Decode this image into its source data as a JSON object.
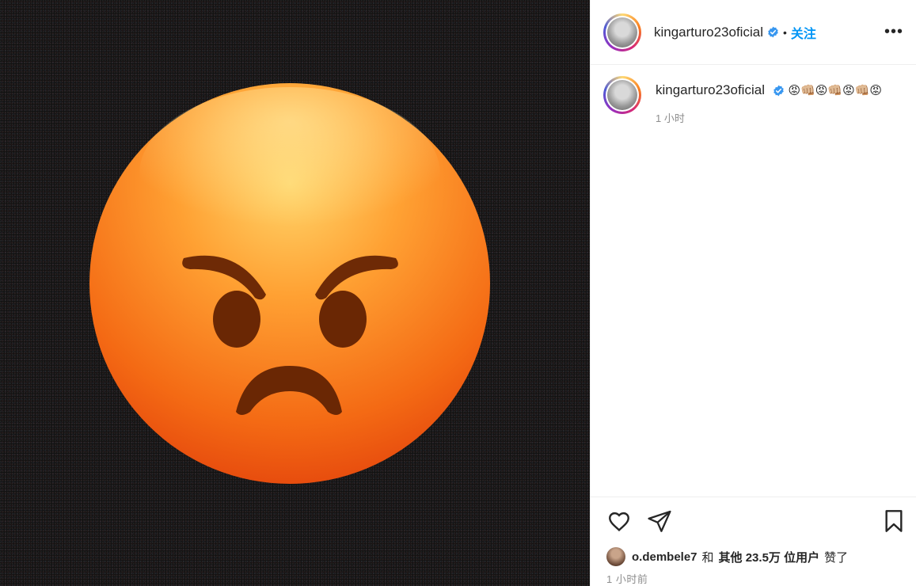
{
  "post": {
    "author": {
      "username": "kingarturo23oficial",
      "verified": true,
      "follow_label": "关注",
      "more_label": "•••"
    },
    "caption": {
      "username": "kingarturo23oficial",
      "emoji_text": "😡👊🏼😡👊🏼😡👊🏼😡",
      "time": "1 小时"
    },
    "likes": {
      "first_liker": "o.dembele7",
      "connector": "和",
      "others_label": "其他 23.5万 位用户",
      "suffix": "赞了"
    },
    "timestamp": "1 小时前"
  },
  "colors": {
    "accent": "#0095f6",
    "verified": "#3897f0",
    "muted_text": "#8e8e8e",
    "divider": "#efefef"
  },
  "icons": {
    "like": "heart-icon",
    "share": "send-icon",
    "save": "bookmark-icon",
    "verified": "verified-badge-icon"
  },
  "media": {
    "subject": "angry-face-emoji"
  }
}
